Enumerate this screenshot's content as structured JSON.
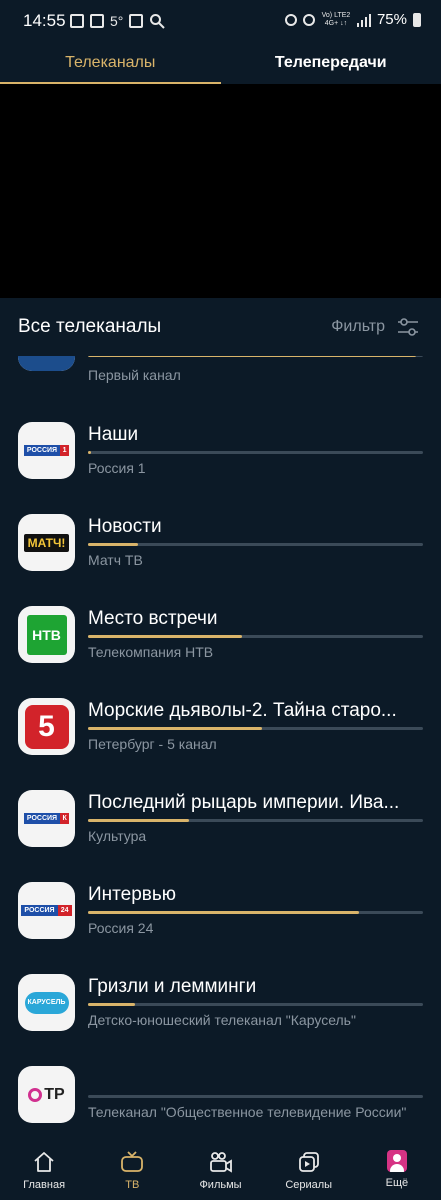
{
  "status_bar": {
    "time": "14:55",
    "temperature": "5°",
    "network": "Vo) LTE2 4G+ ↓↑",
    "battery": "75%"
  },
  "tabs": [
    {
      "label": "Телеканалы",
      "active": true
    },
    {
      "label": "Телепередачи",
      "active": false
    }
  ],
  "section": {
    "title": "Все телеканалы",
    "filter_label": "Фильтр"
  },
  "channels": [
    {
      "program": "",
      "channel": "Первый канал",
      "progress": 0.98,
      "logo": "perviy-kanal-logo"
    },
    {
      "program": "Наши",
      "channel": "Россия 1",
      "progress": 0.01,
      "logo": "rossia-1-logo"
    },
    {
      "program": "Новости",
      "channel": "Матч ТВ",
      "progress": 0.15,
      "logo": "match-tv-logo"
    },
    {
      "program": "Место встречи",
      "channel": "Телекомпания НТВ",
      "progress": 0.46,
      "logo": "ntv-logo"
    },
    {
      "program": "Морские дьяволы-2. Тайна старо...",
      "channel": "Петербург - 5 канал",
      "progress": 0.52,
      "logo": "5-kanal-logo"
    },
    {
      "program": "Последний рыцарь империи. Ива...",
      "channel": "Культура",
      "progress": 0.3,
      "logo": "rossia-k-logo"
    },
    {
      "program": "Интервью",
      "channel": "Россия 24",
      "progress": 0.81,
      "logo": "rossia-24-logo"
    },
    {
      "program": "Гризли и лемминги",
      "channel": "Детско-юношеский телеканал \"Карусель\"",
      "progress": 0.14,
      "logo": "karusel-logo"
    },
    {
      "program": "",
      "channel": "Телеканал \"Общественное телевидение России\"",
      "progress": 0.0,
      "logo": "otr-logo"
    }
  ],
  "bottom_nav": [
    {
      "label": "Главная",
      "icon": "home-icon",
      "active": false
    },
    {
      "label": "ТВ",
      "icon": "tv-icon",
      "active": true
    },
    {
      "label": "Фильмы",
      "icon": "movie-camera-icon",
      "active": false
    },
    {
      "label": "Сериалы",
      "icon": "series-icon",
      "active": false
    },
    {
      "label": "Ещё",
      "icon": "profile-avatar-icon",
      "active": false
    }
  ],
  "colors": {
    "background": "#0c1a27",
    "accent": "#d9b46a",
    "secondary_text": "#8b96a1"
  }
}
